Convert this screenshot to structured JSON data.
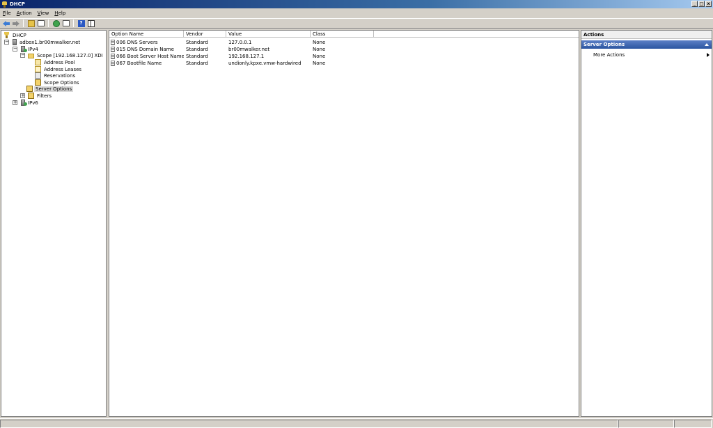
{
  "window": {
    "title": "DHCP",
    "buttons": [
      "_",
      "□",
      "x"
    ]
  },
  "menubar": [
    {
      "ul": "F",
      "rest": "ile"
    },
    {
      "ul": "A",
      "rest": "ction"
    },
    {
      "ul": "V",
      "rest": "iew"
    },
    {
      "ul": "H",
      "rest": "elp"
    }
  ],
  "toolbar": {
    "icons": [
      "back-icon",
      "forward-icon",
      "up-level-icon",
      "show-hide-tree-icon",
      "refresh-icon",
      "export-list-icon",
      "help-icon",
      "show-hide-action-pane-icon"
    ],
    "help_glyph": "?"
  },
  "tree": {
    "root": "DHCP",
    "server": "adbox1.br00mwalker.net",
    "ipv4": "IPv4",
    "scope": "Scope [192.168.127.0] XDI",
    "address_pool": "Address Pool",
    "address_leases": "Address Leases",
    "reservations": "Reservations",
    "scope_options": "Scope Options",
    "server_options": "Server Options",
    "filters": "Filters",
    "ipv6": "IPv6",
    "collapse_glyph": "−",
    "expand_glyph": "+"
  },
  "list": {
    "columns": [
      "Option Name",
      "Vendor",
      "Value",
      "Class"
    ],
    "rows": [
      {
        "name": "006 DNS Servers",
        "vendor": "Standard",
        "value": "127.0.0.1",
        "class": "None"
      },
      {
        "name": "015 DNS Domain Name",
        "vendor": "Standard",
        "value": "br00mwalker.net",
        "class": "None"
      },
      {
        "name": "066 Boot Server Host Name",
        "vendor": "Standard",
        "value": "192.168.127.1",
        "class": "None"
      },
      {
        "name": "067 Bootfile Name",
        "vendor": "Standard",
        "value": "undionly.kpxe.vmw-hardwired",
        "class": "None"
      }
    ]
  },
  "actions": {
    "header": "Actions",
    "section_title": "Server Options",
    "items": [
      "More Actions"
    ]
  },
  "colors": {
    "titlebar_start": "#0a246a",
    "actions_section": "#2b55a0",
    "chrome": "#d4d0c8"
  }
}
